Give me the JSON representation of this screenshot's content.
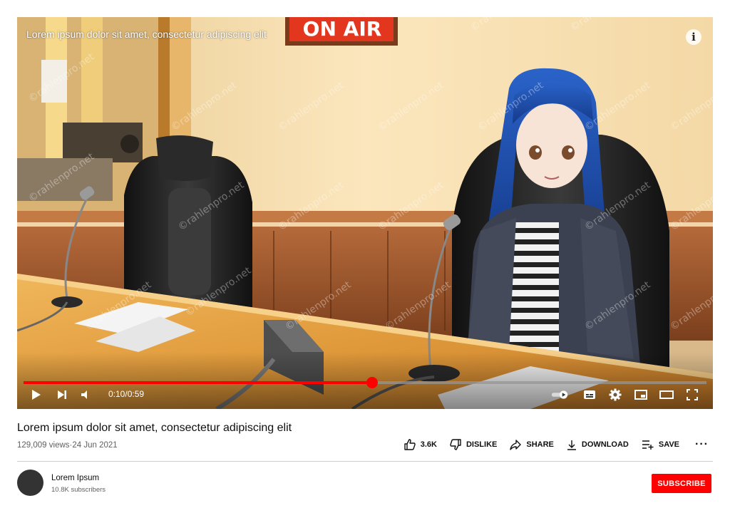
{
  "player": {
    "overlay_title": "Lorem ipsum dolor sit amet, consectetur adipiscing elit",
    "info_label": "i",
    "time": "0:10/0:59",
    "progress": 0.51,
    "sign_text": "ON AIR",
    "watermark": "©rahlenpro.net",
    "accent_color": "#ff0000"
  },
  "video": {
    "title": "Lorem ipsum dolor sit amet, consectetur adipiscing elit",
    "views": "129,009 views",
    "separator": "·",
    "date": "24 Jun 2021"
  },
  "actions": {
    "like": "3.6K",
    "dislike": "DISLIKE",
    "share": "SHARE",
    "download": "DOWNLOAD",
    "save": "SAVE",
    "more": "···"
  },
  "channel": {
    "name": "Lorem Ipsum",
    "subscribers": "10.8K subscribers",
    "subscribe_label": "SUBSCRIBE"
  }
}
